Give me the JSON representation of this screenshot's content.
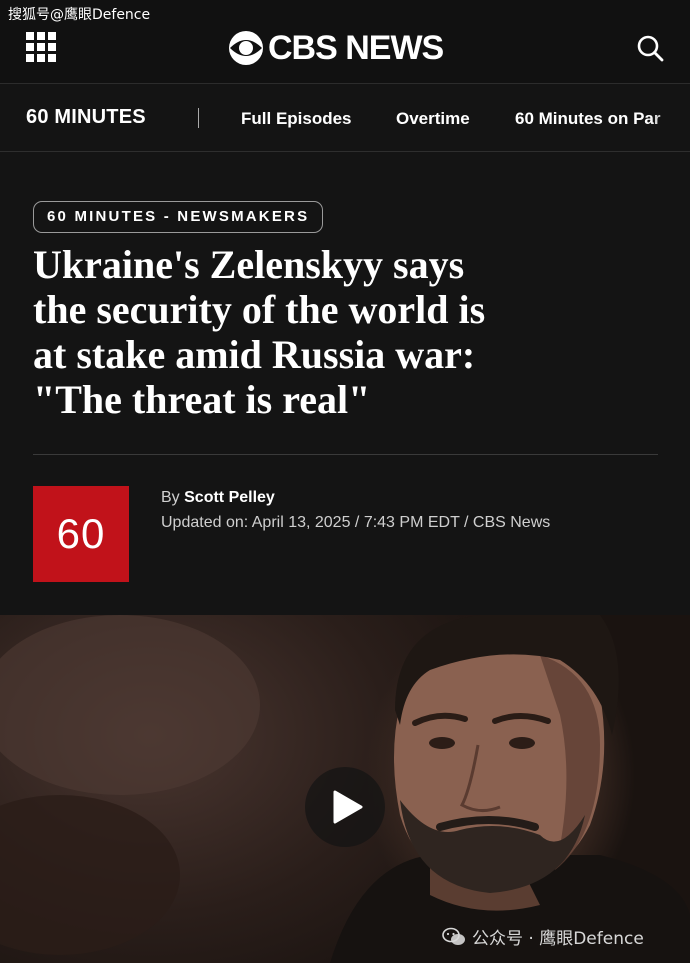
{
  "watermark_top": "搜狐号@鹰眼Defence",
  "header": {
    "logo_text": "CBS NEWS",
    "menu_icon": "grid-menu-icon",
    "search_icon": "search-icon"
  },
  "subnav": {
    "brand": "60 MINUTES",
    "items": [
      "Full Episodes",
      "Overtime",
      "60 Minutes on Par"
    ]
  },
  "article": {
    "section": "60 MINUTES - NEWSMAKERS",
    "headline_lines": [
      "Ukraine's Zelenskyy says",
      "the security of the world is",
      "at stake amid Russia war:",
      "\"The threat is real\""
    ],
    "show_logo_text": "60",
    "by_prefix": "By",
    "author": "Scott Pelley",
    "dateline": "Updated on: April 13, 2025 / 7:43 PM EDT / CBS News"
  },
  "video": {
    "play_icon": "play-icon"
  },
  "watermark_bottom": "公众号 · 鹰眼Defence",
  "colors": {
    "background": "#141414",
    "show_logo_red": "#c1121a"
  }
}
